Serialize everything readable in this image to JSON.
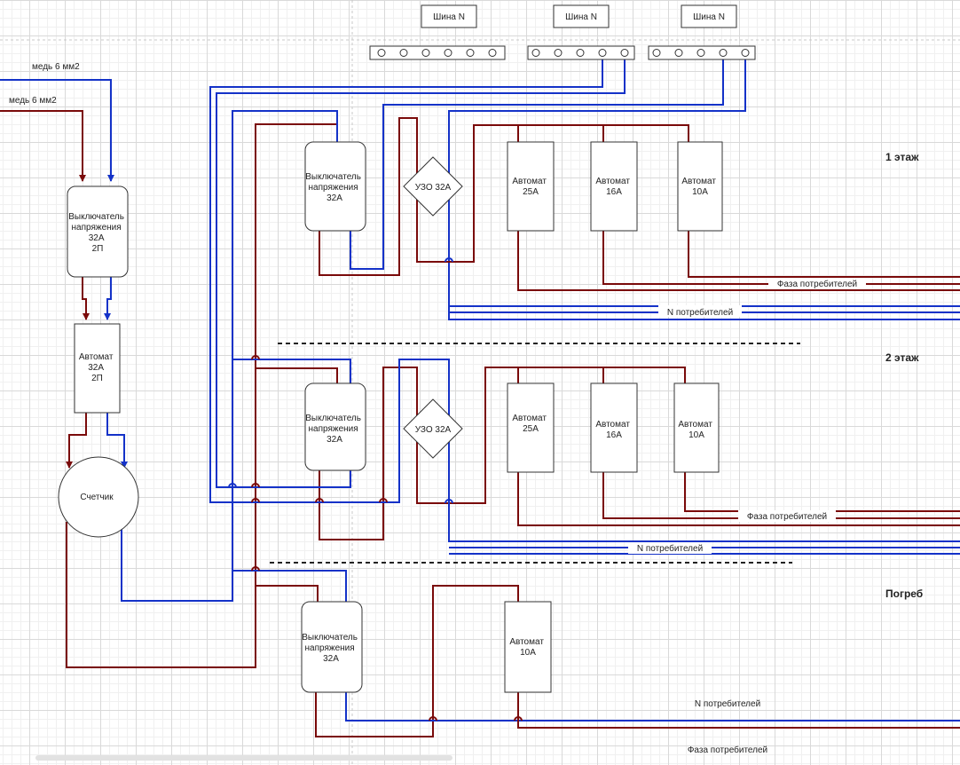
{
  "buses": {
    "bus1": "Шина N",
    "bus2": "Шина N",
    "bus3": "Шина N"
  },
  "inputs": {
    "blue_cable": "медь 6 мм2",
    "red_cable": "медь 6 мм2"
  },
  "main": {
    "switch": [
      "Выключатель",
      "напряжения",
      "32А",
      "2П"
    ],
    "breaker": [
      "Автомат",
      "32А",
      "2П"
    ],
    "meter": "Счетчик"
  },
  "floor1": {
    "title": "1 этаж",
    "switch": [
      "Выключатель",
      "напряжения",
      "32А"
    ],
    "rcd": "УЗО 32А",
    "breakers": [
      [
        "Автомат",
        "25А"
      ],
      [
        "Автомат",
        "16А"
      ],
      [
        "Автомат",
        "10А"
      ]
    ],
    "phase_label": "Фаза потребителей",
    "n_label": "N потребителей"
  },
  "floor2": {
    "title": "2 этаж",
    "switch": [
      "Выключатель",
      "напряжения",
      "32А"
    ],
    "rcd": "УЗО 32А",
    "breakers": [
      [
        "Автомат",
        "25А"
      ],
      [
        "Автомат",
        "16А"
      ],
      [
        "Автомат",
        "10А"
      ]
    ],
    "phase_label": "Фаза потребителей",
    "n_label": "N потребителей"
  },
  "basement": {
    "title": "Погреб",
    "switch": [
      "Выключатель",
      "напряжения",
      "32А"
    ],
    "breakers": [
      [
        "Автомат",
        "10А"
      ]
    ],
    "n_label": "N потребителей",
    "phase_label": "Фаза потребителей"
  },
  "colors": {
    "phase": "#7a0a0a",
    "neutral": "#1432c8"
  }
}
